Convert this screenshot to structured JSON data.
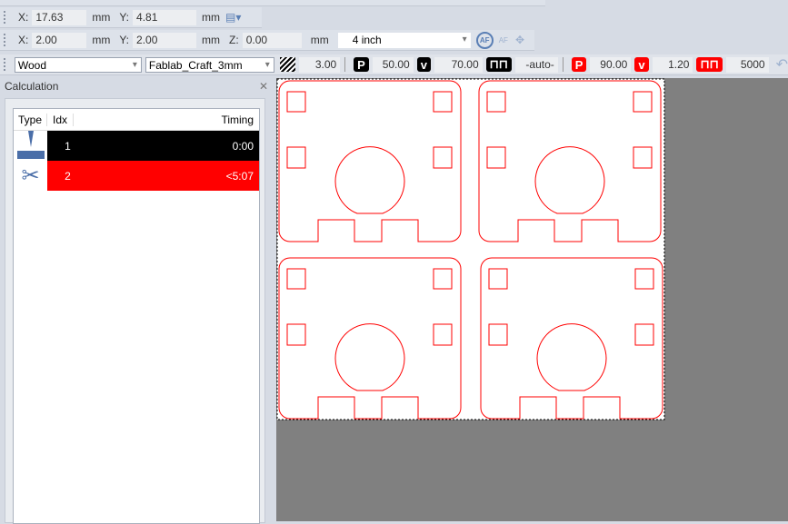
{
  "position_bar": {
    "x_label": "X:",
    "x": "17.63",
    "y_label": "Y:",
    "y": "4.81",
    "unit": "mm"
  },
  "offset_bar": {
    "x_label": "X:",
    "x": "2.00",
    "y_label": "Y:",
    "y": "2.00",
    "z_label": "Z:",
    "z": "0.00",
    "unit": "mm",
    "lens": "4 inch"
  },
  "material_bar": {
    "material": "Wood",
    "profile": "Fablab_Craft_3mm",
    "thickness": "3.00",
    "engrave_power": "50.00",
    "engrave_speed": "70.00",
    "engrave_freq": "-auto-",
    "cut_power": "90.00",
    "cut_speed": "1.20",
    "cut_freq": "5000",
    "icons": {
      "p": "P",
      "v": "v"
    },
    "colors": {
      "engrave": "#000000",
      "cut": "#ff0000"
    }
  },
  "calculation": {
    "title": "Calculation",
    "columns": [
      "Type",
      "Idx",
      "Timing"
    ],
    "rows": [
      {
        "type": "engrave-icon",
        "idx": "1",
        "timing": "0:00",
        "color": "#000000"
      },
      {
        "type": "scissors-icon",
        "idx": "2",
        "timing": "<5:07",
        "color": "#ff0000"
      }
    ]
  }
}
